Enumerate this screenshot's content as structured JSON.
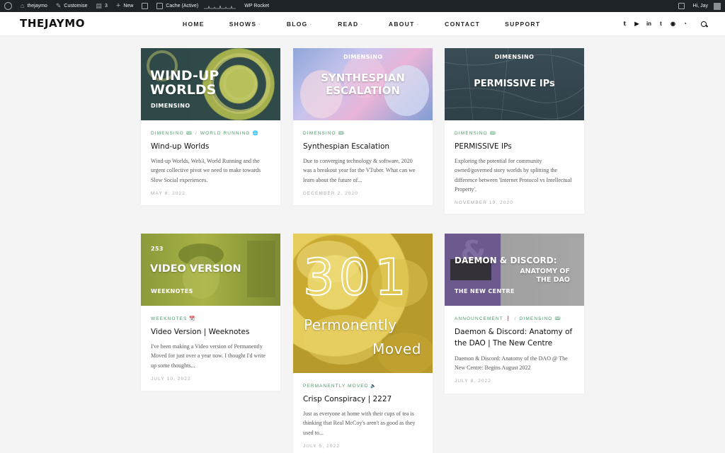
{
  "admin_bar": {
    "site": "thejaymo",
    "customise": "Customise",
    "comments": "3",
    "new": "New",
    "cache": "Cache (Active)",
    "rocket": "WP Rocket",
    "greeting": "Hi, Jay"
  },
  "header": {
    "logo": "THEJAYMO",
    "nav": [
      {
        "label": "HOME",
        "dropdown": false
      },
      {
        "label": "SHOWS",
        "dropdown": true
      },
      {
        "label": "BLOG",
        "dropdown": true
      },
      {
        "label": "READ",
        "dropdown": true
      },
      {
        "label": "ABOUT",
        "dropdown": true
      },
      {
        "label": "CONTACT",
        "dropdown": false
      },
      {
        "label": "SUPPORT",
        "dropdown": false
      }
    ],
    "social_icons": [
      "twitter-icon",
      "youtube-icon",
      "linkedin-icon",
      "tumblr-icon",
      "spotify-icon",
      "rss-icon",
      "search-icon"
    ]
  },
  "posts": [
    {
      "thumb_title": "WIND-UP WORLDS",
      "thumb_sub": "DIMENSINO",
      "categories": [
        "DIMENSINO 🎟",
        "WORLD RUNNING 🌐"
      ],
      "title": "Wind-up Worlds",
      "excerpt": "Wind-up Worlds, Web3, World Running and the urgent collective pivot we need to make towards Slow Social experiences.",
      "date": "MAY 8, 2022"
    },
    {
      "thumb_title": "SYNTHESPIAN ESCALATION",
      "thumb_sub": "DIMENSINO",
      "categories": [
        "DIMENSINO 🎟"
      ],
      "title": "Synthespian Escalation",
      "excerpt": "Due to converging technology & software, 2020 was a breakout year for the VTuber. What can we learn about the future of...",
      "date": "DECEMBER 2, 2020"
    },
    {
      "thumb_title": "PERMISSIVE IPs",
      "thumb_sub": "DIMENSINO",
      "categories": [
        "DIMENSINO 🎟"
      ],
      "title": "PERMISSIVE IPs",
      "excerpt": "Exploring the potential for community owned/governed story worlds by splitting the difference between 'Internet Protocol vs Intellectual Property'.",
      "date": "NOVEMBER 19, 2020"
    },
    {
      "thumb_title": "VIDEO VERSION",
      "thumb_top": "253",
      "thumb_sub": "WEEKNOTES",
      "categories": [
        "WEEKNOTES 📆"
      ],
      "title": "Video Version | Weeknotes",
      "excerpt": "I've been making a Video version of Permanently Moved for just over a year now. I thought I'd write up some thoughts...",
      "date": "JULY 10, 2022"
    },
    {
      "thumb_big": "301",
      "thumb_line1": "Permonently",
      "thumb_line2": "Moved",
      "categories": [
        "PERMANENTLY MOVED 🔈"
      ],
      "title": "Crisp Conspiracy | 2227",
      "excerpt": "Just as everyone at home with their cups of tea is thinking that Real McCoy's aren't as good as they used to...",
      "date": "JULY 5, 2022"
    },
    {
      "thumb_title": "DAEMON & DISCORD:",
      "thumb_title2": "ANATOMY OF THE DAO",
      "thumb_sub": "THE NEW CENTRE",
      "categories": [
        "ANNOUNCEMENT ❗",
        "DIMENSINO 🎟"
      ],
      "title": "Daemon & Discord: Anatomy of the DAO | The New Centre",
      "excerpt": "Daemon & Discord: Anatomy of the DAO @ The New Centre: Begins August 2022",
      "date": "JULY 8, 2022"
    }
  ],
  "colors": {
    "category_green": "#4b9b6a",
    "admin_bar_bg": "#1d2327"
  }
}
